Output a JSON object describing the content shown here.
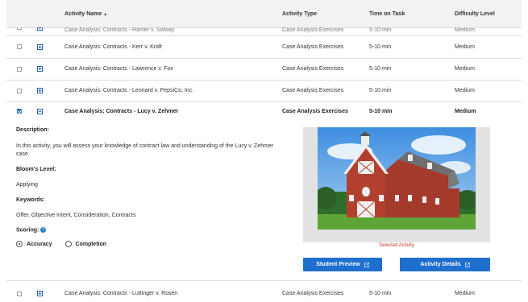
{
  "table": {
    "headers": {
      "activity_name": "Activity Name",
      "activity_type": "Activity Type",
      "time_on_task": "Time on Task",
      "difficulty": "Difficulty Level"
    },
    "partial_row": {
      "name": "Case Analysis: Contracts - Hamer v. Sidway",
      "type": "Case Analysis Exercises",
      "time": "5-10 min",
      "difficulty": "Medium"
    },
    "rows": [
      {
        "name": "Case Analysis: Contracts - Kerr v. Kraft",
        "type": "Case Analysis Exercises",
        "time": "5-10 min",
        "difficulty": "Medium"
      },
      {
        "name": "Case Analysis: Contracts - Lawrence v. Fox",
        "type": "Case Analysis Exercises",
        "time": "5-10 min",
        "difficulty": "Medium"
      },
      {
        "name": "Case Analysis: Contracts - Leonard v. PepsiCo, Inc.",
        "type": "Case Analysis Exercises",
        "time": "5-10 min",
        "difficulty": "Medium"
      }
    ],
    "expanded_row": {
      "name": "Case Analysis: Contracts - Lucy v. Zehmer",
      "type": "Case Analysis Exercises",
      "time": "5-10 min",
      "difficulty": "Medium"
    },
    "last_row": {
      "name": "Case Analysis: Contracts - Luttinger v. Rosen",
      "type": "Case Analysis Exercises",
      "time": "5-10 min",
      "difficulty": "Medium"
    }
  },
  "detail": {
    "description_label": "Description:",
    "description_text": "In this activity, you will assess your knowledge of contract law and understanding of the Lucy v. Zehmer case.",
    "blooms_label": "Bloom's Level:",
    "blooms_value": "Applying",
    "keywords_label": "Keywords:",
    "keywords_value": "Offer, Objective Intent, Consideration, Contracts",
    "scoring_label": "Scoring:",
    "scoring_options": [
      "Accuracy",
      "Completion"
    ],
    "scoring_selected": "Accuracy",
    "image_caption": "Selected Activity",
    "student_preview_label": "Student Preview",
    "activity_details_label": "Activity Details"
  },
  "colors": {
    "accent": "#1f6fcf",
    "caption": "#c0392b",
    "header_bg": "#f2f2f2"
  }
}
